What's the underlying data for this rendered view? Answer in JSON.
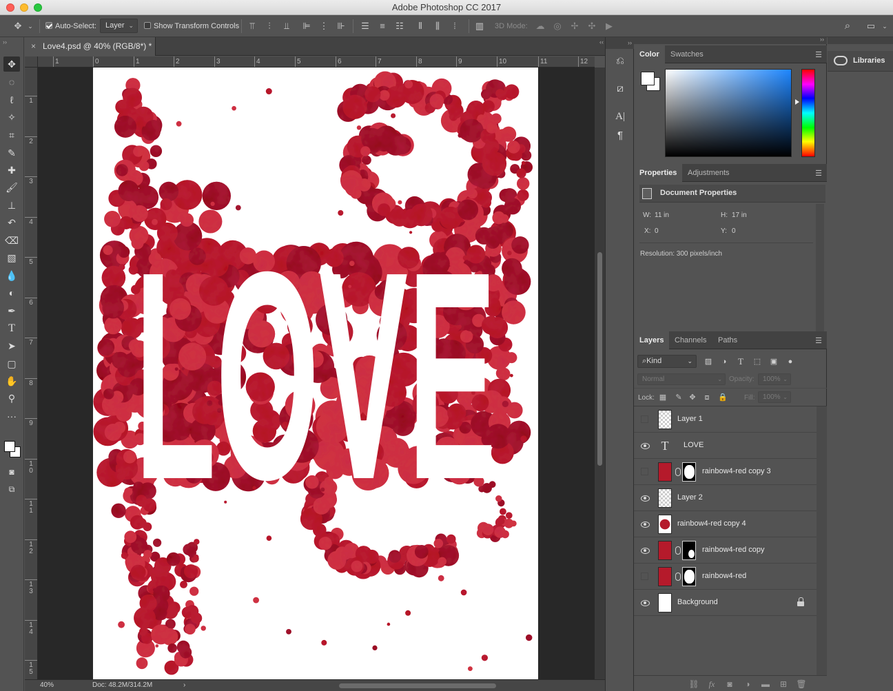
{
  "window": {
    "title": "Adobe Photoshop CC 2017"
  },
  "options_bar": {
    "auto_select_label": "Auto-Select:",
    "auto_select_value": "Layer",
    "show_transform_label": "Show Transform Controls",
    "mode_3d_label": "3D Mode:"
  },
  "document": {
    "tab_title": "Love4.psd @ 40% (RGB/8*) *",
    "zoom": "40%",
    "doc_size": "Doc: 48.2M/314.2M",
    "ruler_h": [
      "1",
      "0",
      "1",
      "2",
      "3",
      "4",
      "5",
      "6",
      "7",
      "8",
      "9",
      "10",
      "11",
      "12"
    ],
    "ruler_v": [
      "1",
      "2",
      "3",
      "4",
      "5",
      "6",
      "7",
      "8",
      "9",
      "10",
      "11",
      "12",
      "13",
      "14",
      "15"
    ],
    "art_text": "LOVE"
  },
  "colors": {
    "paint_red": "#b3151f",
    "paint_red_dark": "#8f0f18",
    "paint_red_light": "#d1343f"
  },
  "color_panel": {
    "tabs": [
      "Color",
      "Swatches"
    ]
  },
  "properties_panel": {
    "tabs": [
      "Properties",
      "Adjustments"
    ],
    "section_title": "Document Properties",
    "w_label": "W:",
    "w_value": "11 in",
    "h_label": "H:",
    "h_value": "17 in",
    "x_label": "X:",
    "x_value": "0",
    "y_label": "Y:",
    "y_value": "0",
    "resolution": "Resolution: 300 pixels/inch"
  },
  "layers_panel": {
    "tabs": [
      "Layers",
      "Channels",
      "Paths"
    ],
    "kind_label": "Kind",
    "blend_mode": "Normal",
    "opacity_label": "Opacity:",
    "opacity_value": "100%",
    "lock_label": "Lock:",
    "fill_label": "Fill:",
    "fill_value": "100%",
    "layers": [
      {
        "name": "Layer 1",
        "visible": false,
        "thumb": "checker"
      },
      {
        "name": "LOVE",
        "visible": true,
        "thumb": "type"
      },
      {
        "name": "rainbow4-red copy 3",
        "visible": false,
        "thumb": "red",
        "mask": "full"
      },
      {
        "name": "Layer 2",
        "visible": true,
        "thumb": "checker"
      },
      {
        "name": "rainbow4-red copy 4",
        "visible": true,
        "thumb": "redwhite"
      },
      {
        "name": "rainbow4-red copy",
        "visible": true,
        "thumb": "red",
        "mask": "partial"
      },
      {
        "name": "rainbow4-red",
        "visible": false,
        "thumb": "red",
        "mask": "full"
      },
      {
        "name": "Background",
        "visible": true,
        "thumb": "white",
        "locked": true
      }
    ]
  },
  "libraries": {
    "label": "Libraries"
  },
  "icons": {
    "move": "move-tool-icon",
    "search": "search-icon",
    "workspace": "workspace-icon"
  }
}
